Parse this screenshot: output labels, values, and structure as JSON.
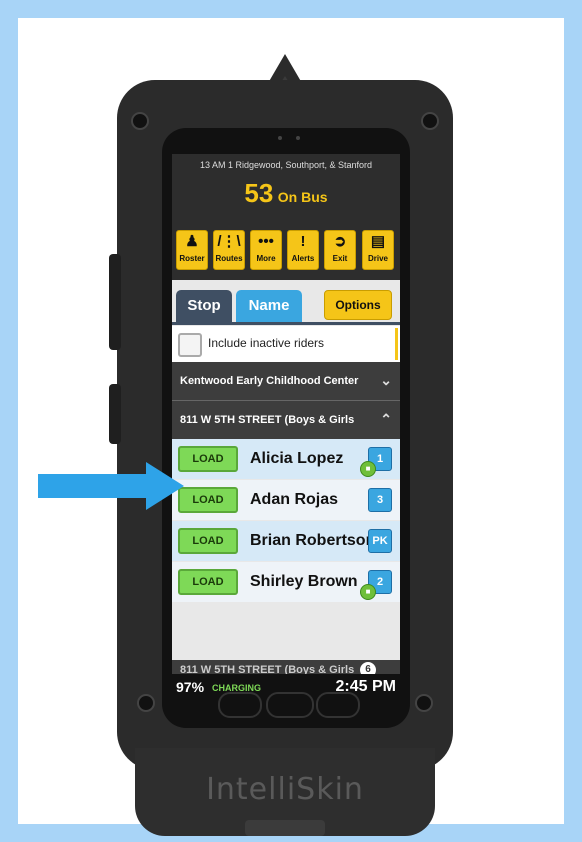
{
  "app": {
    "route_title": "13 AM 1 Ridgewood, Southport, & Stanford",
    "on_bus_count": "53",
    "on_bus_label": "On Bus"
  },
  "toolbar": {
    "buttons": [
      {
        "label": "Roster",
        "icon": "person-icon"
      },
      {
        "label": "Routes",
        "icon": "road-icon"
      },
      {
        "label": "More",
        "icon": "dots-icon"
      },
      {
        "label": "Alerts",
        "icon": "exclamation-icon"
      },
      {
        "label": "Exit",
        "icon": "exit-door-icon"
      },
      {
        "label": "Drive",
        "icon": "bus-icon"
      }
    ]
  },
  "tabs": {
    "stop": "Stop",
    "name": "Name",
    "options": "Options"
  },
  "filters": {
    "include_inactive": "Include inactive riders"
  },
  "groups": [
    {
      "title": "Kentwood Early Childhood Center",
      "expanded": false
    },
    {
      "title": "811 W 5TH STREET (Boys & Girls",
      "expanded": true
    }
  ],
  "riders": [
    {
      "load_label": "LOAD",
      "name": "Alicia Lopez",
      "grade": "1",
      "has_bus_badge": true
    },
    {
      "load_label": "LOAD",
      "name": "Adan Rojas",
      "grade": "3",
      "has_bus_badge": false
    },
    {
      "load_label": "LOAD",
      "name": "Brian Robertson",
      "grade": "PK",
      "has_bus_badge": false
    },
    {
      "load_label": "LOAD",
      "name": "Shirley Brown",
      "grade": "2",
      "has_bus_badge": true
    }
  ],
  "next_group_partial": {
    "title": "811 W 5TH STREET (Boys & Girls",
    "count": "6"
  },
  "status": {
    "battery": "97%",
    "charging": "CHARGING",
    "time": "2:45 PM"
  },
  "device": {
    "brand": "IntelliSkin"
  },
  "colors": {
    "accent_yellow": "#f5c518",
    "tab_blue": "#3aa6e0",
    "load_green": "#7ed957",
    "callout_arrow": "#2ea3e8",
    "background": "#a8d4f7"
  }
}
